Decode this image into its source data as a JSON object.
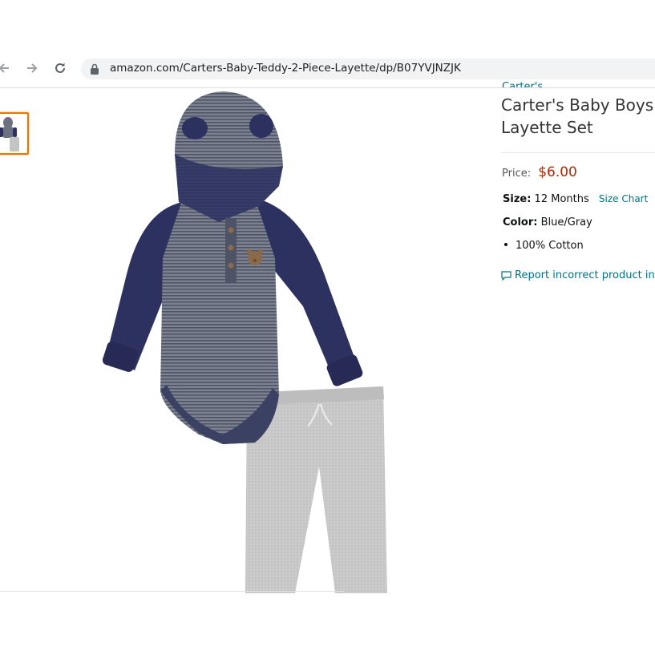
{
  "browser": {
    "url_text": "amazon.com/Carters-Baby-Teddy-2-Piece-Layette/dp/B07YVJNZJK",
    "back_icon": "arrow-left-icon",
    "forward_icon": "arrow-right-icon",
    "reload_icon": "reload-icon",
    "lock_icon": "lock-icon"
  },
  "product": {
    "brand": "Carter's",
    "title_line1": "Carter's Baby Boys' T",
    "title_line2": "Layette Set",
    "price_label": "Price:",
    "price_value": "$6.00",
    "size_label": "Size:",
    "size_value": "12 Months",
    "size_chart_label": "Size Chart",
    "color_label": "Color:",
    "color_value": "Blue/Gray",
    "features": [
      "100% Cotton"
    ],
    "report_label": "Report incorrect product infor"
  },
  "colors": {
    "link": "#007185",
    "price": "#b12704",
    "thumb_border": "#e77600",
    "navy": "#2c3160",
    "stripe_gray": "#6d7280",
    "pants_gray": "#c4c4c4"
  }
}
